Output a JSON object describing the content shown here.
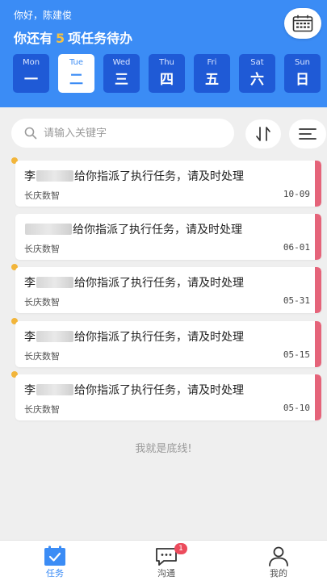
{
  "header": {
    "greeting": "你好，陈建俊",
    "task_prefix": "你还有",
    "task_count": "5",
    "task_suffix": "项任务待办",
    "calendar_icon": "calendar-icon"
  },
  "week": [
    {
      "en": "Mon",
      "cn": "一",
      "active": false
    },
    {
      "en": "Tue",
      "cn": "二",
      "active": true
    },
    {
      "en": "Wed",
      "cn": "三",
      "active": false
    },
    {
      "en": "Thu",
      "cn": "四",
      "active": false
    },
    {
      "en": "Fri",
      "cn": "五",
      "active": false
    },
    {
      "en": "Sat",
      "cn": "六",
      "active": false
    },
    {
      "en": "Sun",
      "cn": "日",
      "active": false
    }
  ],
  "search": {
    "placeholder": "请输入关键字",
    "icon": "search-icon",
    "sort_icon": "sort-icon",
    "filter_icon": "filter-icon"
  },
  "tasks": [
    {
      "name_visible": "李",
      "text": "给你指派了执行任务，请及时处理",
      "org": "长庆数智",
      "date": "10-09"
    },
    {
      "name_visible": "",
      "text": "给你指派了执行任务，请及时处理",
      "org": "长庆数智",
      "date": "06-01"
    },
    {
      "name_visible": "李",
      "text": "给你指派了执行任务，请及时处理",
      "org": "长庆数智",
      "date": "05-31"
    },
    {
      "name_visible": "李",
      "text": "给你指派了执行任务，请及时处理",
      "org": "长庆数智",
      "date": "05-15"
    },
    {
      "name_visible": "李",
      "text": "给你指派了执行任务，请及时处理",
      "org": "长庆数智",
      "date": "05-10"
    }
  ],
  "end_text": "我就是底线!",
  "tabs": [
    {
      "label": "任务",
      "icon": "task-calendar-icon",
      "active": true
    },
    {
      "label": "沟通",
      "icon": "chat-icon",
      "badge": "1",
      "active": false
    },
    {
      "label": "我的",
      "icon": "person-icon",
      "active": false
    }
  ],
  "colors": {
    "header_blue": "#3b8cf5",
    "day_blue": "#1f5ad6",
    "count_yellow": "#f5c242",
    "unread_dot": "#f2b53a",
    "status_bar": "#e5647a",
    "badge_red": "#ec4b5c"
  }
}
